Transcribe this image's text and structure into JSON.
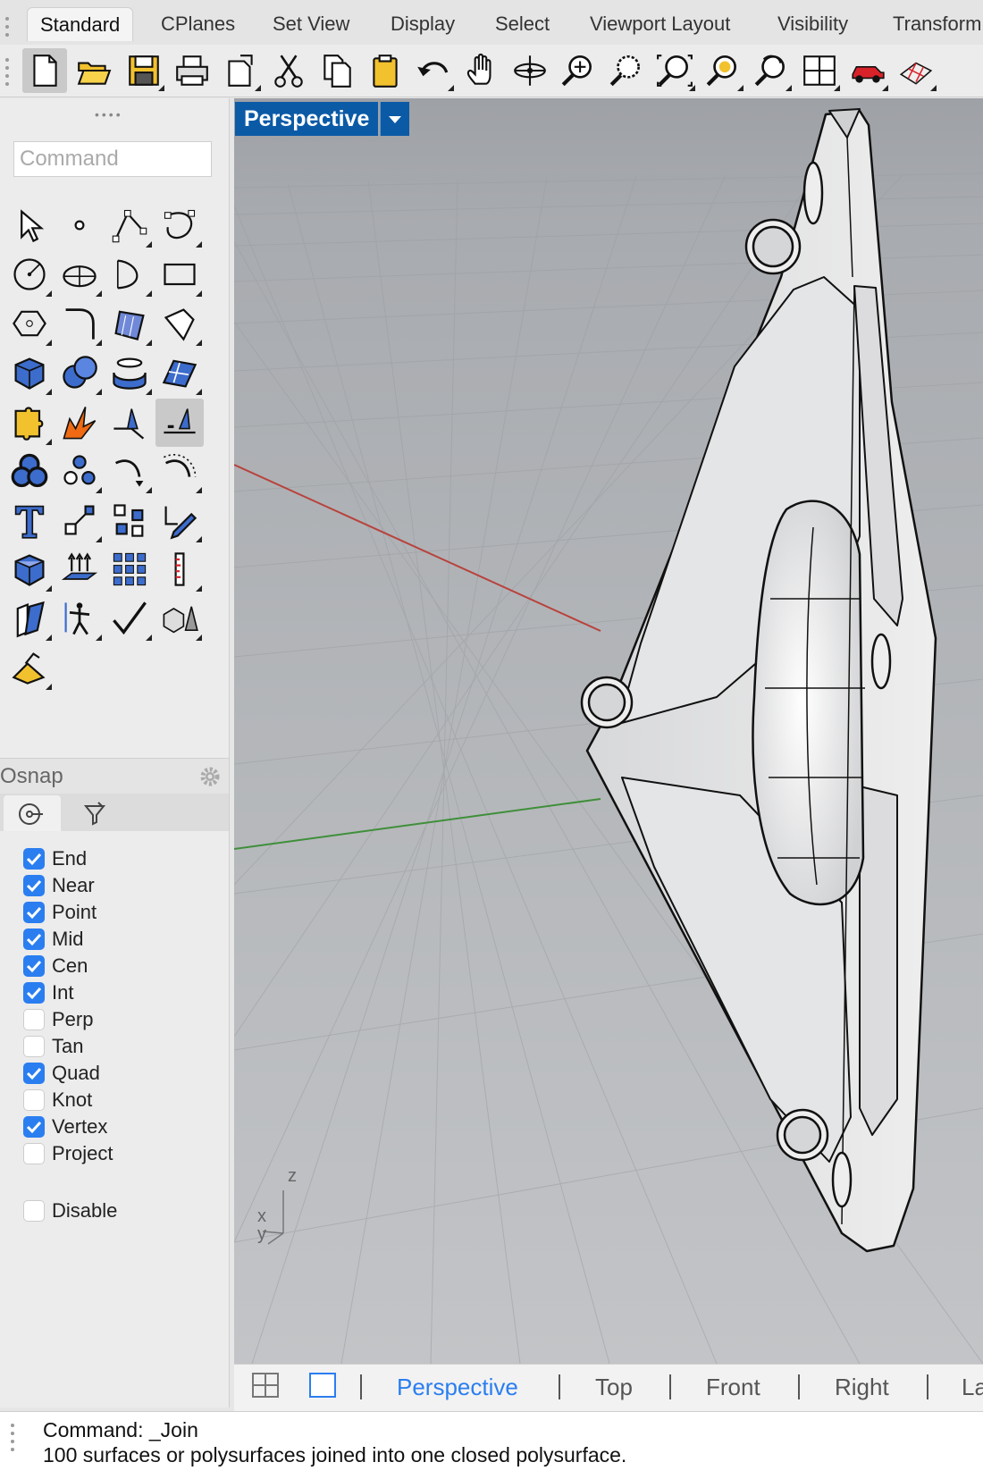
{
  "tabs": [
    "Standard",
    "CPlanes",
    "Set View",
    "Display",
    "Select",
    "Viewport Layout",
    "Visibility",
    "Transform"
  ],
  "active_tab": "Standard",
  "toolbar_icons": [
    "new-document-icon",
    "open-folder-icon",
    "save-icon",
    "print-icon",
    "export-icon",
    "cut-icon",
    "copy-icon",
    "paste-icon",
    "undo-icon",
    "pan-hand-icon",
    "rotate-view-icon",
    "zoom-dynamic-icon",
    "zoom-window-icon",
    "zoom-extents-icon",
    "zoom-selected-icon",
    "undo-view-icon",
    "four-viewports-icon",
    "render-car-icon",
    "plane-grid-icon"
  ],
  "command_placeholder": "Command",
  "tool_icons": [
    [
      "select-arrow-icon",
      "point-icon",
      "polyline-icon",
      "curve-icon"
    ],
    [
      "circle-icon",
      "ellipse-icon",
      "arc-icon",
      "rectangle-icon"
    ],
    [
      "polygon-icon",
      "fillet-curve-icon",
      "surface-corner-icon",
      "surface-edge-icon"
    ],
    [
      "box-icon",
      "sphere-icon",
      "cylinder-icon",
      "surface-icon"
    ],
    [
      "join-puzzle-icon",
      "explode-icon",
      "trim-icon",
      "split-icon"
    ],
    [
      "boolean-union-icon",
      "boolean-split-icon",
      "offset-curve-icon",
      "fillet-arc-icon"
    ],
    [
      "text-icon",
      "scale-icon",
      "array-icon",
      "move-pencil-icon"
    ],
    [
      "solid-box-icon",
      "extrude-arrows-icon",
      "grid-array-icon",
      "ruler-icon"
    ],
    [
      "surface-edit-icon",
      "figure-transform-icon",
      "check-icon",
      "shaded-solids-icon"
    ],
    [
      "drafting-plane-icon"
    ]
  ],
  "osnap": {
    "title": "Osnap",
    "items": [
      {
        "label": "End",
        "checked": true
      },
      {
        "label": "Near",
        "checked": true
      },
      {
        "label": "Point",
        "checked": true
      },
      {
        "label": "Mid",
        "checked": true
      },
      {
        "label": "Cen",
        "checked": true
      },
      {
        "label": "Int",
        "checked": true
      },
      {
        "label": "Perp",
        "checked": false
      },
      {
        "label": "Tan",
        "checked": false
      },
      {
        "label": "Quad",
        "checked": true
      },
      {
        "label": "Knot",
        "checked": false
      },
      {
        "label": "Vertex",
        "checked": true
      },
      {
        "label": "Project",
        "checked": false
      }
    ],
    "disable_label": "Disable",
    "disable_checked": false
  },
  "viewport": {
    "title": "Perspective",
    "axis_labels": {
      "z": "z",
      "y": "y",
      "x": "x"
    }
  },
  "viewport_tabs": [
    "Perspective",
    "Top",
    "Front",
    "Right",
    "La"
  ],
  "active_viewport_tab": "Perspective",
  "command_history": [
    "Command: _Join",
    "100 surfaces or polysurfaces joined into one closed polysurface."
  ]
}
